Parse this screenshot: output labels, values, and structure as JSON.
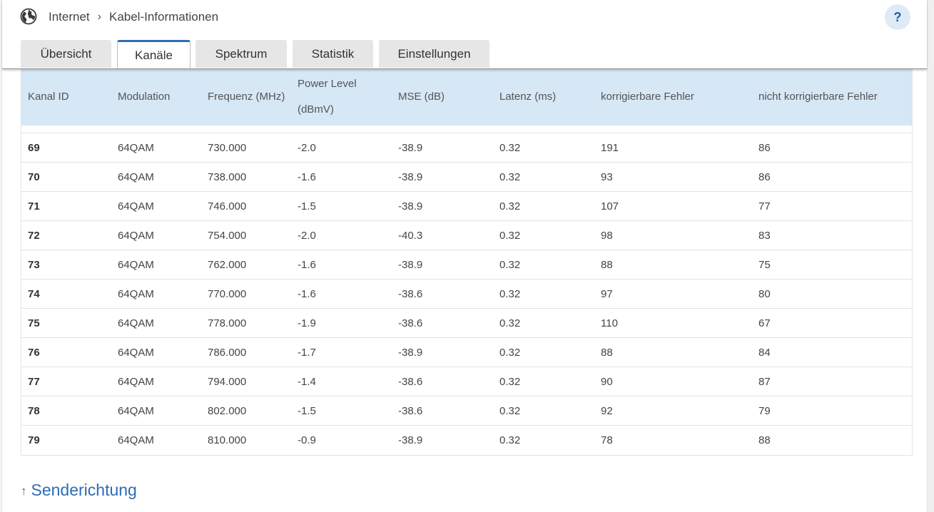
{
  "breadcrumb": {
    "root": "Internet",
    "separator": "›",
    "current": "Kabel-Informationen"
  },
  "help": {
    "label": "?"
  },
  "tabs": [
    {
      "label": "Übersicht",
      "active": false
    },
    {
      "label": "Kanäle",
      "active": true
    },
    {
      "label": "Spektrum",
      "active": false
    },
    {
      "label": "Statistik",
      "active": false
    },
    {
      "label": "Einstellungen",
      "active": false
    }
  ],
  "table": {
    "headers": [
      "Kanal ID",
      "Modulation",
      "Frequenz (MHz)",
      "Power Level\n(dBmV)",
      "MSE (dB)",
      "Latenz (ms)",
      "korrigierbare Fehler",
      "nicht korrigierbare Fehler"
    ],
    "rows": [
      [
        "69",
        "64QAM",
        "730.000",
        "-2.0",
        "-38.9",
        "0.32",
        "191",
        "86"
      ],
      [
        "70",
        "64QAM",
        "738.000",
        "-1.6",
        "-38.9",
        "0.32",
        "93",
        "86"
      ],
      [
        "71",
        "64QAM",
        "746.000",
        "-1.5",
        "-38.9",
        "0.32",
        "107",
        "77"
      ],
      [
        "72",
        "64QAM",
        "754.000",
        "-2.0",
        "-40.3",
        "0.32",
        "98",
        "83"
      ],
      [
        "73",
        "64QAM",
        "762.000",
        "-1.6",
        "-38.9",
        "0.32",
        "88",
        "75"
      ],
      [
        "74",
        "64QAM",
        "770.000",
        "-1.6",
        "-38.6",
        "0.32",
        "97",
        "80"
      ],
      [
        "75",
        "64QAM",
        "778.000",
        "-1.9",
        "-38.6",
        "0.32",
        "110",
        "67"
      ],
      [
        "76",
        "64QAM",
        "786.000",
        "-1.7",
        "-38.9",
        "0.32",
        "88",
        "84"
      ],
      [
        "77",
        "64QAM",
        "794.000",
        "-1.4",
        "-38.6",
        "0.32",
        "90",
        "87"
      ],
      [
        "78",
        "64QAM",
        "802.000",
        "-1.5",
        "-38.6",
        "0.32",
        "92",
        "79"
      ],
      [
        "79",
        "64QAM",
        "810.000",
        "-0.9",
        "-38.9",
        "0.32",
        "78",
        "88"
      ]
    ]
  },
  "section": {
    "arrow": "↑",
    "title": "Senderichtung"
  },
  "colors": {
    "accent": "#2d6db4",
    "header_bg": "#d6e7f6",
    "help_bg": "#deebf7"
  },
  "icons": {
    "globe": "globe-icon",
    "up_arrow": "arrow-up-icon"
  }
}
